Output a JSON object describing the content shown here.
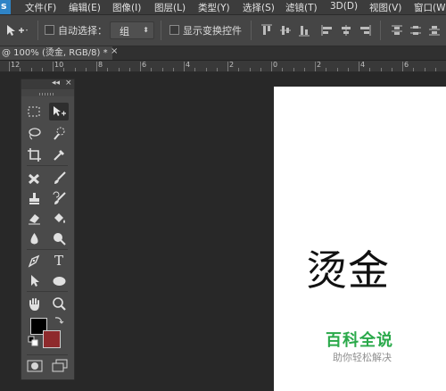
{
  "app": {
    "logo_text": "s",
    "menu": [
      "文件(F)",
      "编辑(E)",
      "图像(I)",
      "图层(L)",
      "类型(Y)",
      "选择(S)",
      "滤镜(T)",
      "3D(D)",
      "视图(V)",
      "窗口(W)"
    ]
  },
  "options": {
    "auto_select_label": "自动选择：",
    "auto_select_checked": false,
    "auto_select_value": "组",
    "show_transform_label": "显示变换控件",
    "show_transform_checked": false
  },
  "document_tab": {
    "title": "@ 100% (烫金, RGB/8) *",
    "close": "×"
  },
  "ruler": {
    "labels": [
      "12",
      "10",
      "8",
      "6",
      "4",
      "2",
      "0",
      "2",
      "4",
      "6",
      "8",
      "10",
      "12"
    ]
  },
  "toolbox": {
    "collapse": "◂◂",
    "close": "×",
    "type_tool_glyph": "T",
    "foreground_color": "#000000",
    "background_color": "#8e2a2c"
  },
  "canvas": {
    "text": "烫金"
  },
  "watermark": {
    "title": "百科全说",
    "subtitle": "助你轻松解决",
    "color": "#2aa94a"
  }
}
